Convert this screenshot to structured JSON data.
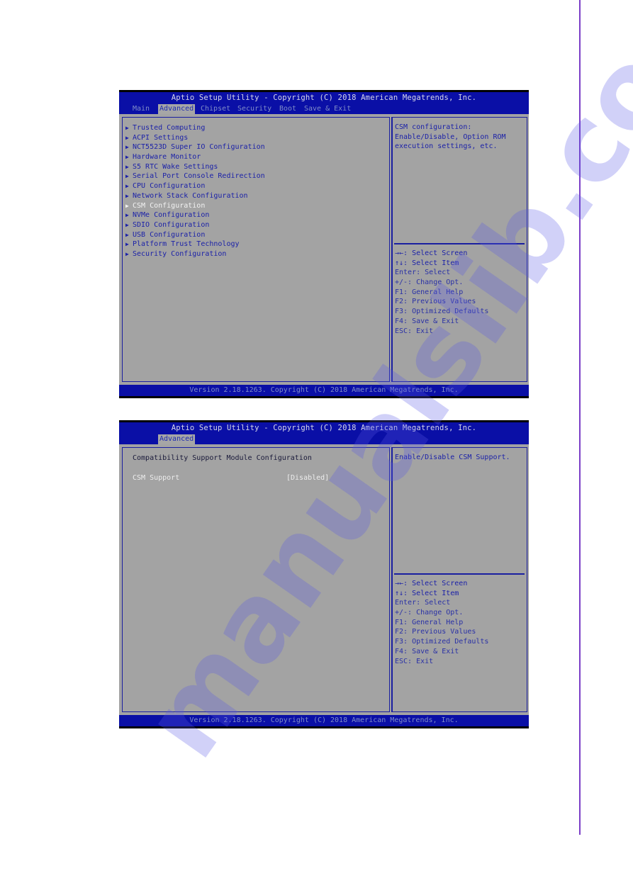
{
  "screen1": {
    "header_title": "Aptio Setup Utility - Copyright (C) 2018 American Megatrends, Inc.",
    "tabs": [
      {
        "label": "Main",
        "active": false
      },
      {
        "label": "Advanced",
        "active": true
      },
      {
        "label": "Chipset",
        "active": false
      },
      {
        "label": "Security",
        "active": false
      },
      {
        "label": "Boot",
        "active": false
      },
      {
        "label": "Save & Exit",
        "active": false
      }
    ],
    "menu_items": [
      {
        "label": "Trusted Computing",
        "selected": false
      },
      {
        "label": "ACPI Settings",
        "selected": false
      },
      {
        "label": "NCT5523D Super IO Configuration",
        "selected": false
      },
      {
        "label": "Hardware Monitor",
        "selected": false
      },
      {
        "label": "S5 RTC Wake Settings",
        "selected": false
      },
      {
        "label": "Serial Port Console Redirection",
        "selected": false
      },
      {
        "label": "CPU Configuration",
        "selected": false
      },
      {
        "label": "Network Stack Configuration",
        "selected": false
      },
      {
        "label": "CSM Configuration",
        "selected": true
      },
      {
        "label": "NVMe Configuration",
        "selected": false
      },
      {
        "label": "SDIO Configuration",
        "selected": false
      },
      {
        "label": "USB Configuration",
        "selected": false
      },
      {
        "label": "Platform Trust Technology",
        "selected": false
      },
      {
        "label": "Security Configuration",
        "selected": false
      }
    ],
    "help_text": "CSM configuration:\nEnable/Disable, Option ROM\nexecution settings, etc.",
    "footer": "Version 2.18.1263. Copyright (C) 2018 American Megatrends, Inc."
  },
  "screen2": {
    "header_title": "Aptio Setup Utility - Copyright (C) 2018 American Megatrends, Inc.",
    "tabs": [
      {
        "label": "Advanced",
        "active": true
      }
    ],
    "section_title": "Compatibility Support Module Configuration",
    "settings": [
      {
        "label": "CSM Support",
        "value": "[Disabled]"
      }
    ],
    "help_text": "Enable/Disable CSM Support.",
    "footer": "Version 2.18.1263. Copyright (C) 2018 American Megatrends, Inc."
  },
  "key_help": [
    {
      "key": "→←:",
      "desc": " Select Screen"
    },
    {
      "key": "↑↓:",
      "desc": " Select Item"
    },
    {
      "key": "Enter:",
      "desc": " Select"
    },
    {
      "key": "+/-:",
      "desc": " Change Opt."
    },
    {
      "key": "F1:",
      "desc": " General Help"
    },
    {
      "key": "F2:",
      "desc": " Previous Values"
    },
    {
      "key": "F3:",
      "desc": " Optimized Defaults"
    },
    {
      "key": "F4:",
      "desc": " Save & Exit"
    },
    {
      "key": "ESC:",
      "desc": " Exit"
    }
  ],
  "icons": {
    "submenu_arrow": "▶"
  },
  "watermark": "manualslib.com",
  "colors": {
    "bios_blue": "#0a0fa6",
    "panel_gray": "#a3a3a3",
    "text_blue": "#1c22a8",
    "highlight_white": "#f2f2f2",
    "page_rule": "#7b3fc7"
  }
}
